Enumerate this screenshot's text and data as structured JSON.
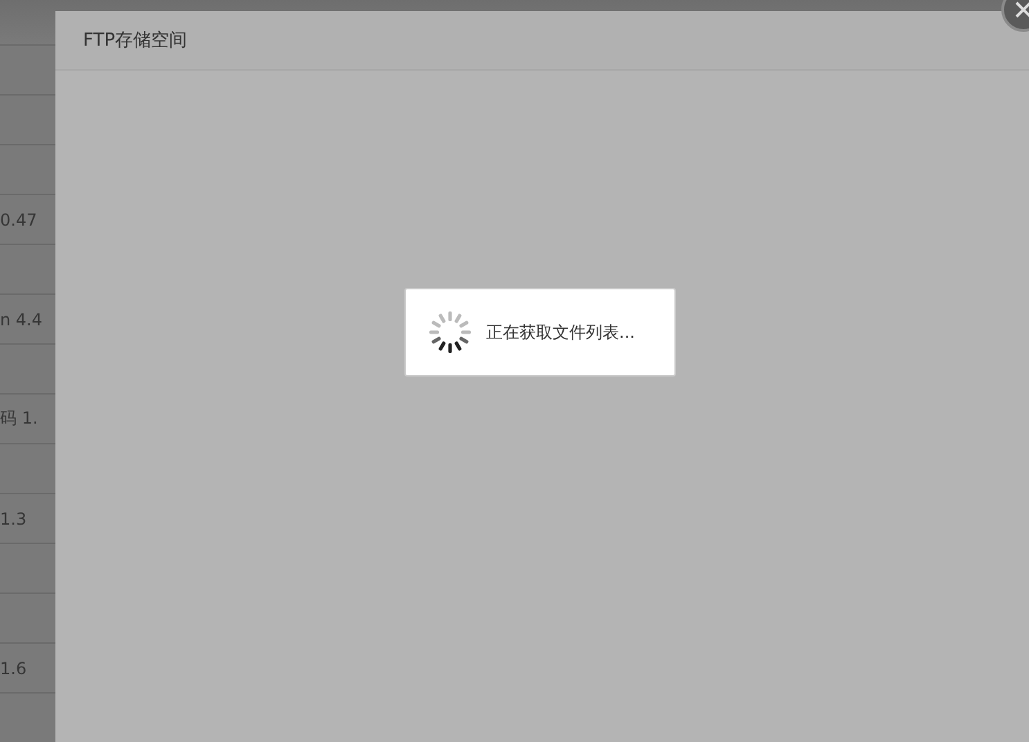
{
  "background_list": {
    "rows": [
      {
        "text": ""
      },
      {
        "text": ""
      },
      {
        "text": ""
      },
      {
        "text": "0.47"
      },
      {
        "text": ""
      },
      {
        "text": "n 4.4"
      },
      {
        "text": ""
      },
      {
        "text": "码 1."
      },
      {
        "text": ""
      },
      {
        "text": "1.3"
      },
      {
        "text": ""
      },
      {
        "text": ""
      },
      {
        "text": "1.6"
      },
      {
        "text": ""
      }
    ]
  },
  "dialog": {
    "title": "FTP存储空间",
    "loading": {
      "message": "正在获取文件列表..."
    }
  }
}
